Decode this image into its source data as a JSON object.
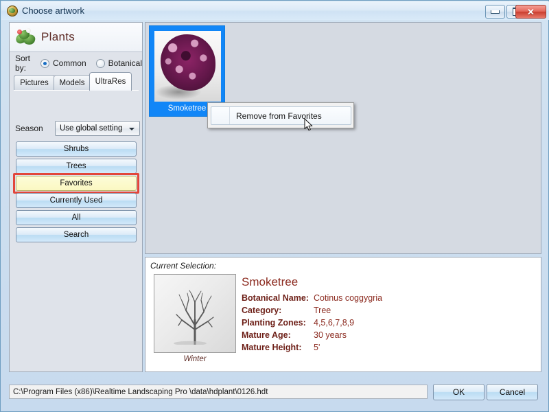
{
  "window": {
    "title": "Choose artwork",
    "icon": "app-globe-icon",
    "minimize_label": "",
    "maximize_label": "",
    "close_label": "✕"
  },
  "sidebar": {
    "header": {
      "title": "Plants",
      "icon": "plant-bush-icon"
    },
    "sort_by": {
      "label": "Sort by:",
      "options": [
        {
          "label": "Common",
          "selected": true
        },
        {
          "label": "Botanical",
          "selected": false
        }
      ]
    },
    "tabs": [
      {
        "label": "Pictures",
        "active": false
      },
      {
        "label": "Models",
        "active": false
      },
      {
        "label": "UltraRes",
        "active": true
      }
    ],
    "season": {
      "label": "Season",
      "value": "Use global setting"
    },
    "buttons": [
      {
        "label": "Shrubs",
        "highlighted": false
      },
      {
        "label": "Trees",
        "highlighted": false
      },
      {
        "label": "Favorites",
        "highlighted": true
      },
      {
        "label": "Currently Used",
        "highlighted": false
      },
      {
        "label": "All",
        "highlighted": false
      },
      {
        "label": "Search",
        "highlighted": false
      }
    ]
  },
  "gallery": {
    "items": [
      {
        "label": "Smoketree",
        "selected": true,
        "thumbnail": "purple-smoketree-foliage"
      }
    ]
  },
  "context_menu": {
    "items": [
      {
        "label": "Remove from Favorites",
        "highlighted": true
      }
    ]
  },
  "cursor": {
    "name": "mouse-pointer"
  },
  "current_selection": {
    "caption": "Current Selection:",
    "name": "Smoketree",
    "season_caption": "Winter",
    "thumbnail": "winter-bare-tree",
    "fields": [
      {
        "key": "Botanical Name:",
        "value": "Cotinus coggygria"
      },
      {
        "key": "Category:",
        "value": "Tree"
      },
      {
        "key": "Planting Zones:",
        "value": "4,5,6,7,8,9"
      },
      {
        "key": "Mature Age:",
        "value": "30 years"
      },
      {
        "key": "Mature Height:",
        "value": "5'"
      }
    ]
  },
  "footer": {
    "path": "C:\\Program Files (x86)\\Realtime Landscaping Pro \\data\\hdplant\\0126.hdt",
    "ok_label": "OK",
    "cancel_label": "Cancel"
  },
  "colors": {
    "selection_blue": "#1186f7",
    "favorites_yellow": "#fbf8c2",
    "focus_red": "#e2463b",
    "detail_text": "#8c2b20",
    "titlebar": "#dceaf7"
  }
}
